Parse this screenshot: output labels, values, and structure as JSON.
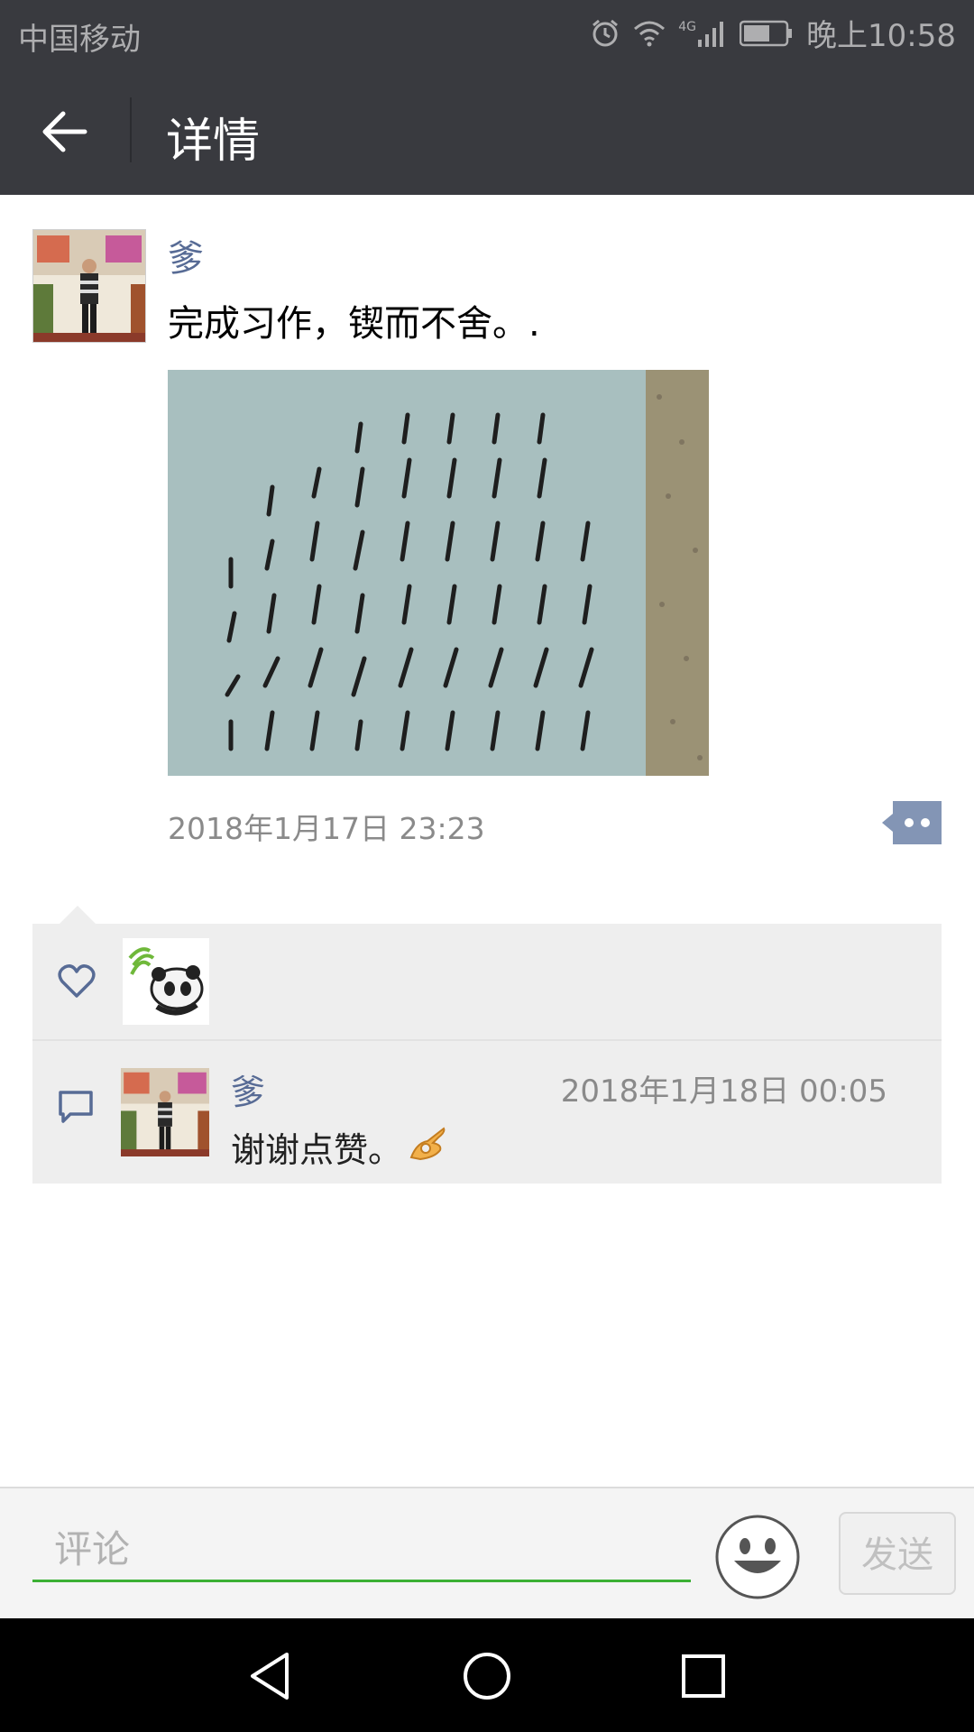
{
  "status_bar": {
    "carrier": "中国移动",
    "network": "4G",
    "time": "晚上10:58"
  },
  "header": {
    "title": "详情"
  },
  "post": {
    "author": "爹",
    "text": "完成习作，锲而不舍。.",
    "timestamp": "2018年1月17日 23:23"
  },
  "comments": [
    {
      "author": "爹",
      "time": "2018年1月18日 00:05",
      "text": "谢谢点赞。"
    }
  ],
  "input_bar": {
    "placeholder": "评论",
    "send_label": "发送"
  },
  "icons": [
    "back-icon",
    "alarm-icon",
    "wifi-icon",
    "signal-icon",
    "battery-icon",
    "more-icon",
    "heart-icon",
    "comment-icon",
    "emoji-icon",
    "nav-back-icon",
    "nav-home-icon",
    "nav-recent-icon"
  ],
  "colors": {
    "header_bg": "#393a3f",
    "link_blue": "#576b95",
    "input_underline": "#3cb034"
  }
}
